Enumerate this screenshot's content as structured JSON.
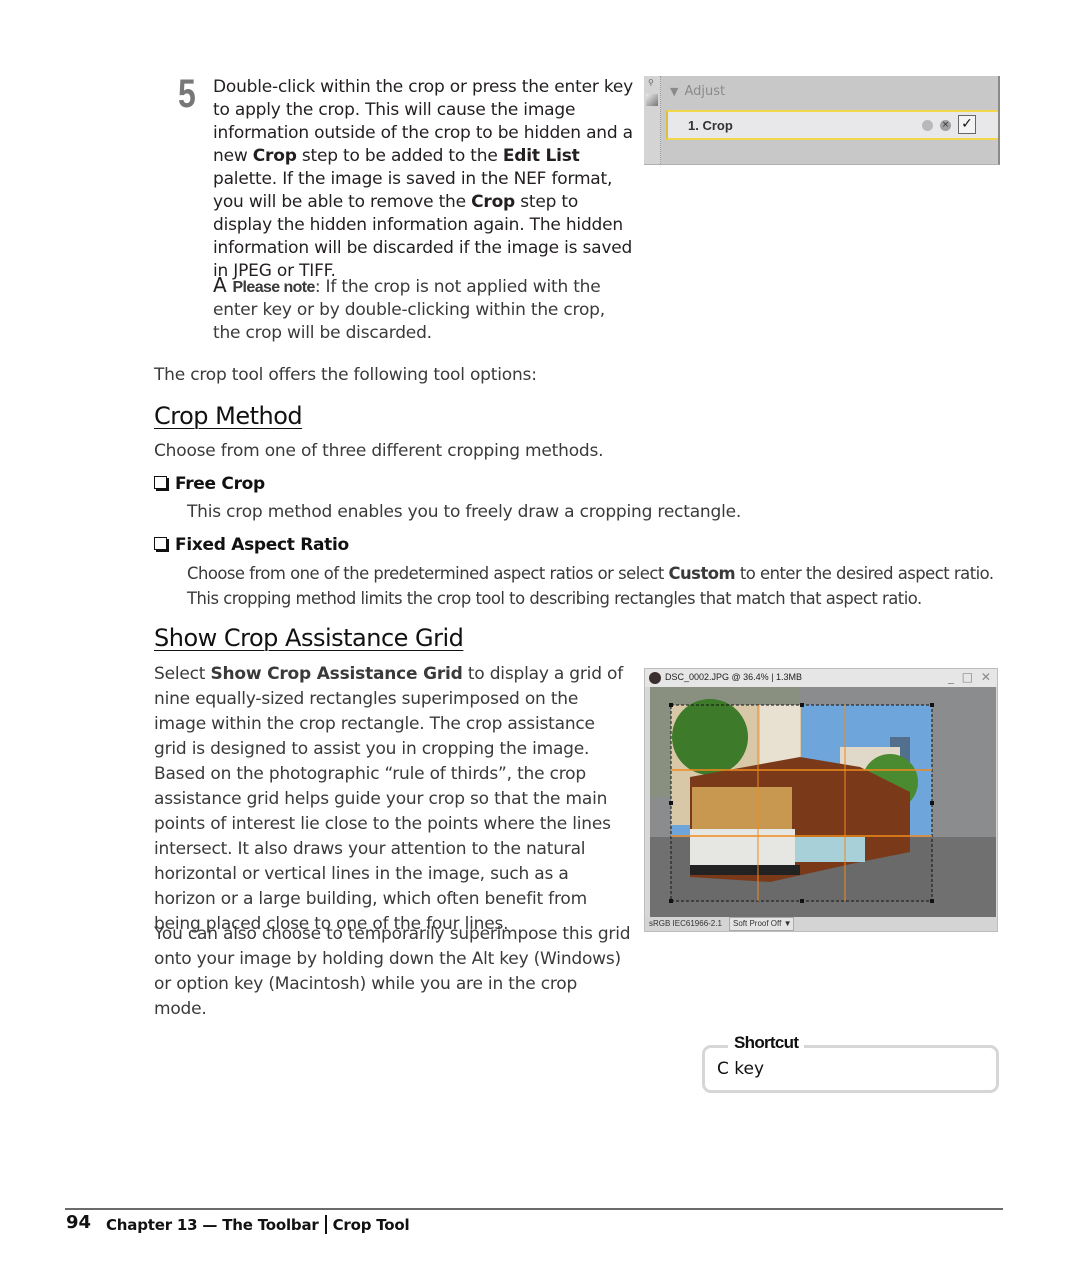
{
  "step": {
    "number": "5",
    "segments": [
      {
        "t": "Double-click within the crop or press the enter key to apply the crop. This will cause the image information outside of the crop to be hidden and a new ",
        "b": false
      },
      {
        "t": "Crop",
        "b": true
      },
      {
        "t": " step to be added to the ",
        "b": false
      },
      {
        "t": "Edit List",
        "b": true
      },
      {
        "t": " palette. If the image is saved in the NEF format, you will be able to remove the ",
        "b": false
      },
      {
        "t": "Crop",
        "b": true
      },
      {
        "t": " step to display the hidden information again. The hidden information will be discarded if the image is saved in JPEG or TIFF.",
        "b": false
      }
    ]
  },
  "note": {
    "icon_letter": "A",
    "label": "Please note",
    "text": ": If the crop is not applied with the enter key or by double-clicking within the crop, the crop will be discarded."
  },
  "intro": "The crop tool offers the following tool options:",
  "sections": {
    "crop_method": {
      "heading": "Crop Method",
      "description": "Choose from one of three different cropping methods.",
      "free_crop": {
        "title": "Free Crop",
        "text": "This crop method enables you to freely draw a cropping rectangle."
      },
      "fixed_aspect": {
        "title": "Fixed Aspect Ratio",
        "line1_a": "Choose from one of the predetermined aspect ratios or select ",
        "line1_b": "Custom",
        "line1_c": " to enter the desired aspect ratio.",
        "line2": "This cropping method limits the crop tool to describing rectangles that match that aspect ratio."
      }
    },
    "grid": {
      "heading": "Show Crop Assistance Grid",
      "p1_a": "Select ",
      "p1_b": "Show Crop Assistance Grid",
      "p1_c": " to display a grid of nine equally-sized rectangles superimposed on the image within the crop rectangle. The crop assistance grid is designed to assist you in cropping the image. Based on the photographic “rule of thirds”, the crop assistance grid helps guide your crop so that the main points of interest lie close to the points where the lines intersect. It also draws your attention to the natural horizontal or vertical lines in the image, such as a horizon or a large building, which often benefit from being placed close to one of the four lines.",
      "p2": "You can also choose to temporarily superimpose this grid onto your image by holding down the Alt key (Windows) or option key (Macintosh) while you are in the crop mode."
    }
  },
  "palette_screenshot": {
    "group_label": "Adjust",
    "step_label": "1. Crop",
    "checked": true,
    "icons": [
      "reset-icon",
      "delete-icon",
      "checkbox-icon"
    ]
  },
  "image_window": {
    "title": "DSC_0002.JPG @ 36.4% | 1.3MB",
    "window_controls": "_ □ ✕",
    "color_profile": "sRGB IEC61966-2.1",
    "soft_proof": "Soft Proof Off",
    "grid_color": "#f08a1c"
  },
  "shortcut": {
    "title": "Shortcut",
    "key": "C key"
  },
  "footer": {
    "page_number": "94",
    "chapter": "Chapter 13 — The Toolbar",
    "section": "Crop Tool"
  }
}
